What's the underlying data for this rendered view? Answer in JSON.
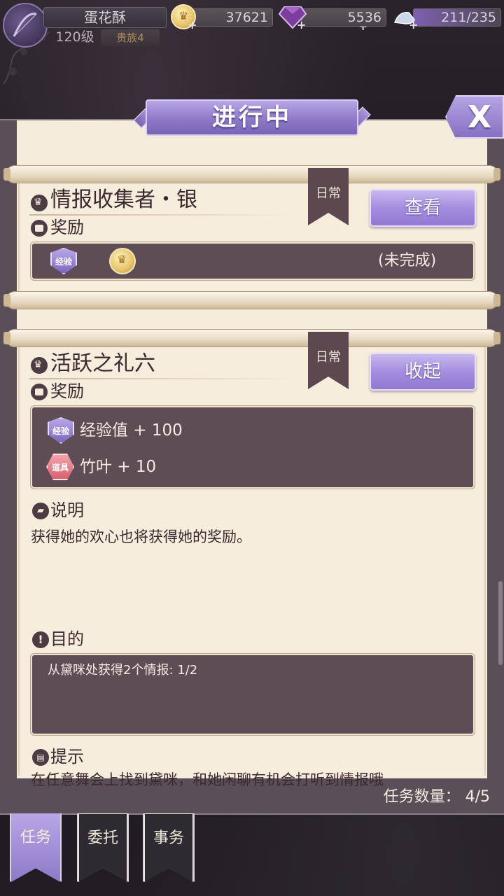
{
  "top_bar": {
    "player_name": "蛋花酥",
    "level": "120级",
    "rank": "贵族4",
    "gold": "37621",
    "diamonds": "5536",
    "stamina": "211/235",
    "plus": "+"
  },
  "panel": {
    "title": "进行中",
    "close_label": "X"
  },
  "quest_1": {
    "tag": "日常",
    "title": "情报收集者・银",
    "reward_label": "奖励",
    "exp_icon_text": "经验",
    "status": "(未完成)",
    "button": "查看"
  },
  "quest_2": {
    "tag": "日常",
    "title": "活跃之礼六",
    "reward_label": "奖励",
    "button": "收起",
    "rewards": [
      {
        "icon_text": "经验",
        "text": "经验值 + 100"
      },
      {
        "icon_text": "道具",
        "text": "竹叶 + 10"
      }
    ],
    "desc_label": "说明",
    "desc_text": "获得她的欢心也将获得她的奖励。",
    "objective_label": "目的",
    "objective_text": "从黛咪处获得2个情报: 1/2",
    "hint_label": "提示",
    "hint_text_cut": "在任意舞会上找到黛咪，和她闲聊有机会打听到情报哦"
  },
  "footer": {
    "task_count": "任务数量：  4/5"
  },
  "tabs": [
    {
      "label": "任务",
      "active": true
    },
    {
      "label": "委托",
      "active": false
    },
    {
      "label": "事务",
      "active": false
    }
  ],
  "colors": {
    "accent_purple": "#9279d3",
    "dark_panel": "#5e4d55",
    "parchment": "#f6eddc"
  }
}
